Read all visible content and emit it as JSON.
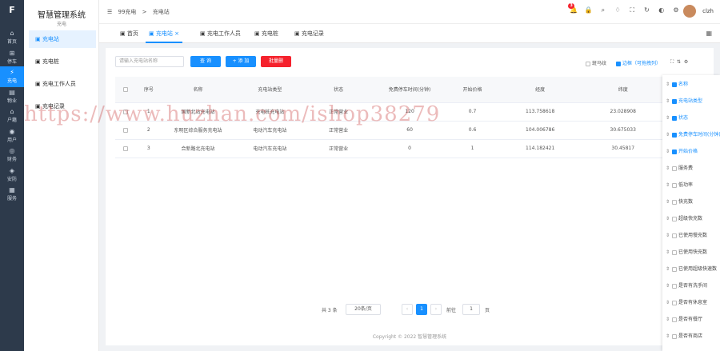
{
  "sidebar_rail": {
    "logo": "F",
    "items": [
      {
        "icon": "home-icon",
        "glyph": "⌂",
        "label": "首页"
      },
      {
        "icon": "car-icon",
        "glyph": "⊞",
        "label": "停车"
      },
      {
        "icon": "charging-icon",
        "glyph": "⚡",
        "label": "充电"
      },
      {
        "icon": "property-icon",
        "glyph": "▤",
        "label": "物业"
      },
      {
        "icon": "household-icon",
        "glyph": "⌂",
        "label": "户籍"
      },
      {
        "icon": "user-icon",
        "glyph": "◉",
        "label": "用户"
      },
      {
        "icon": "finance-icon",
        "glyph": "◎",
        "label": "财务"
      },
      {
        "icon": "security-icon",
        "glyph": "◈",
        "label": "安防"
      },
      {
        "icon": "service-icon",
        "glyph": "▦",
        "label": "服务"
      }
    ],
    "active_index": 2
  },
  "submenu": {
    "title": "智慧管理系统",
    "subtitle": "充电",
    "items": [
      "充电站",
      "充电桩",
      "充电工作人员",
      "充电记录"
    ],
    "active_index": 0
  },
  "topbar": {
    "breadcrumb": [
      "99充电",
      ">",
      "充电站"
    ],
    "notification_count": "3",
    "user_name": "clzh"
  },
  "tabs": [
    "首页",
    "充电站",
    "充电工作人员",
    "充电桩",
    "充电记录"
  ],
  "active_tab": 1,
  "toolbar": {
    "search_placeholder": "请输入充电站名称",
    "query_label": "查 询",
    "add_label": "+ 添 加",
    "delete_label": "批量删",
    "option_striped": "斑马纹",
    "option_border": "边框（可拖拽列）"
  },
  "table": {
    "headers": [
      "序号",
      "名称",
      "充电站类型",
      "状态",
      "免费停车时间(分钟)",
      "开始价格",
      "经度",
      "纬度"
    ],
    "rows": [
      [
        "1",
        "国新北站充电站",
        "充电桩充电站",
        "正常营业",
        "120",
        "0.7",
        "113.758618",
        "23.028908"
      ],
      [
        "2",
        "东明区综合服务充电站",
        "电动汽车充电站",
        "正常营业",
        "60",
        "0.6",
        "104.006786",
        "30.675033"
      ],
      [
        "3",
        "合新路北充电站",
        "电动汽车充电站",
        "正常营业",
        "0",
        "1",
        "114.182421",
        "30.45817"
      ]
    ]
  },
  "pagination": {
    "total": "共 3 条",
    "page_size": "20条/页",
    "current": "1",
    "goto_label": "前往",
    "goto_value": "1",
    "page_suffix": "页"
  },
  "footer": "Copyright © 2022 智慧管理系统",
  "column_panel": {
    "items": [
      {
        "label": "名称",
        "checked": true
      },
      {
        "label": "充电站类型",
        "checked": true
      },
      {
        "label": "状态",
        "checked": true
      },
      {
        "label": "免费停车时间(分钟)",
        "checked": true
      },
      {
        "label": "开始价格",
        "checked": true
      },
      {
        "label": "服务费",
        "checked": false
      },
      {
        "label": "低功率",
        "checked": false
      },
      {
        "label": "快充数",
        "checked": false
      },
      {
        "label": "超级快充数",
        "checked": false
      },
      {
        "label": "已使用慢充数",
        "checked": false
      },
      {
        "label": "已使用快充数",
        "checked": false
      },
      {
        "label": "已使用超级快速数",
        "checked": false
      },
      {
        "label": "是否有洗手间",
        "checked": false
      },
      {
        "label": "是否有休息室",
        "checked": false
      },
      {
        "label": "是否有餐厅",
        "checked": false
      },
      {
        "label": "是否有商店",
        "checked": false
      }
    ]
  },
  "watermark": "https://www.huzhan.com/ishop38279",
  "colors": {
    "accent": "#1890ff",
    "danger": "#f5222d",
    "rail": "#2d3a4b"
  }
}
